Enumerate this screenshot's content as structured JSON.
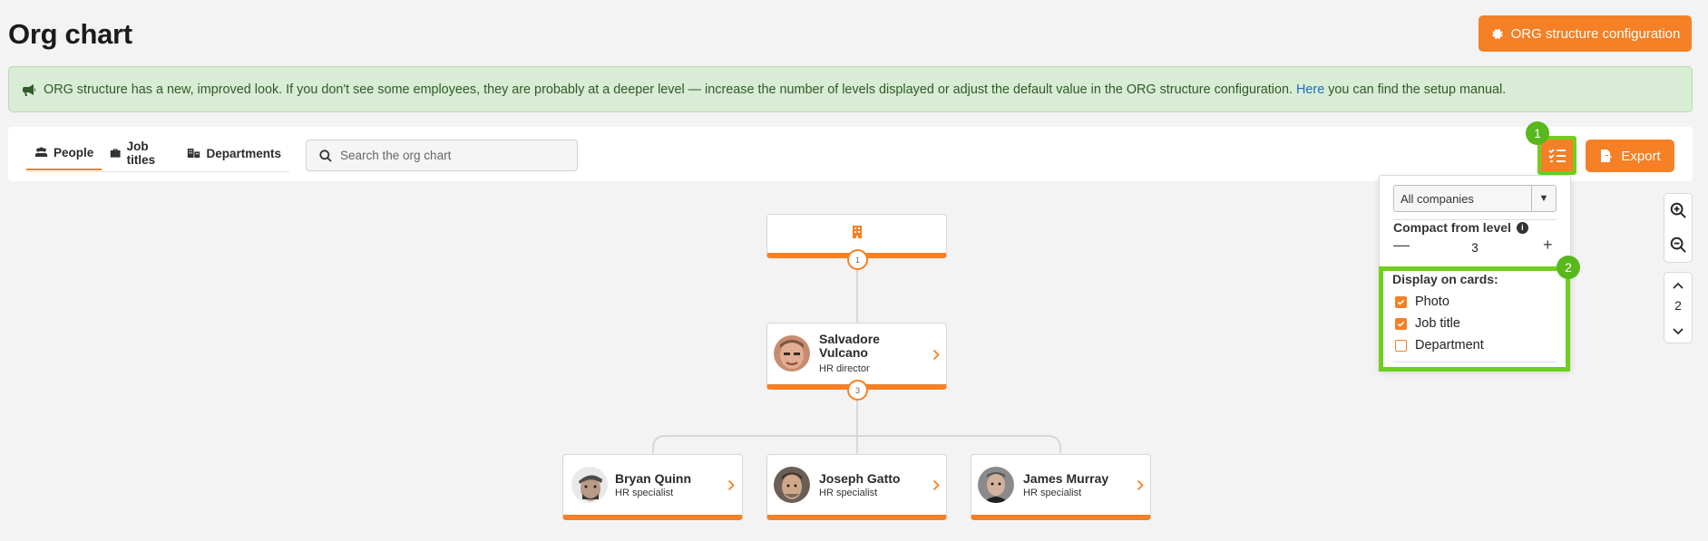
{
  "header": {
    "title": "Org chart",
    "config_button_label": "ORG structure configuration"
  },
  "banner": {
    "text": "ORG structure has a new, improved look. If you don't see some employees, they are probably at a deeper level — increase the number of levels displayed or adjust the default value in the ORG structure configuration.",
    "link_text": "Here",
    "text_after": "you can find the setup manual."
  },
  "tabs": [
    {
      "label": "People",
      "icon": "people-icon",
      "active": true
    },
    {
      "label": "Job titles",
      "icon": "briefcase-icon",
      "active": false
    },
    {
      "label": "Departments",
      "icon": "departments-icon",
      "active": false
    }
  ],
  "search": {
    "placeholder": "Search the org chart",
    "value": ""
  },
  "toolbar": {
    "export_label": "Export"
  },
  "annotations": {
    "badge1": "1",
    "badge2": "2"
  },
  "settings_popover": {
    "company_select": "All companies",
    "compact_label": "Compact from level",
    "compact_value": "3",
    "display_title": "Display on cards:",
    "options": [
      {
        "label": "Photo",
        "checked": true
      },
      {
        "label": "Job title",
        "checked": true
      },
      {
        "label": "Department",
        "checked": false
      }
    ]
  },
  "levels": {
    "value": "2"
  },
  "org": {
    "root": {
      "icon": "building-icon",
      "count": "1"
    },
    "director": {
      "name_line1": "Salvadore",
      "name_line2": "Vulcano",
      "title": "HR director",
      "count": "3"
    },
    "reports": [
      {
        "name": "Bryan Quinn",
        "title": "HR specialist"
      },
      {
        "name": "Joseph Gatto",
        "title": "HR specialist"
      },
      {
        "name": "James Murray",
        "title": "HR specialist"
      }
    ]
  },
  "colors": {
    "accent": "#f58025",
    "highlight": "#6fcf1f",
    "banner_bg": "#d9ecd5"
  }
}
